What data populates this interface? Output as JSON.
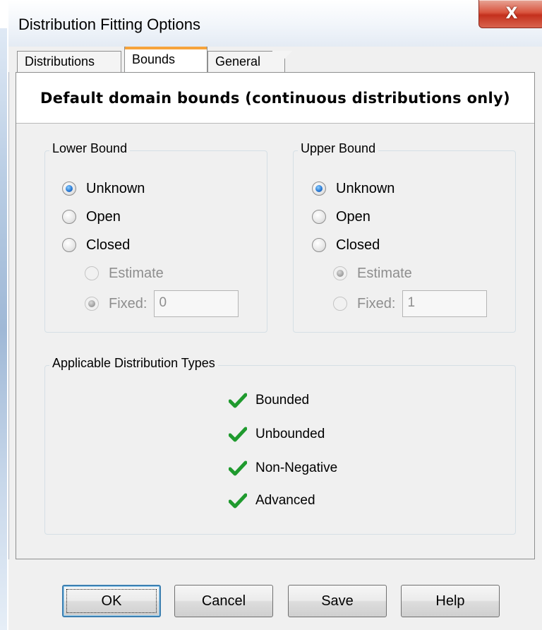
{
  "window": {
    "title": "Distribution Fitting Options",
    "close_label": "X"
  },
  "tabs": [
    {
      "label": "Distributions",
      "active": false
    },
    {
      "label": "Bounds",
      "active": true
    },
    {
      "label": "General",
      "active": false
    }
  ],
  "panel": {
    "header": "Default domain bounds (continuous distributions only)"
  },
  "lower_bound": {
    "label": "Lower Bound",
    "options": [
      "Unknown",
      "Open",
      "Closed"
    ],
    "selected": "Unknown",
    "sub_options": [
      "Estimate",
      "Fixed:"
    ],
    "sub_selected": "Fixed:",
    "fixed_value": "0"
  },
  "upper_bound": {
    "label": "Upper Bound",
    "options": [
      "Unknown",
      "Open",
      "Closed"
    ],
    "selected": "Unknown",
    "sub_options": [
      "Estimate",
      "Fixed:"
    ],
    "sub_selected": "Estimate",
    "fixed_value": "1"
  },
  "distribution_types": {
    "label": "Applicable Distribution Types",
    "items": [
      "Bounded",
      "Unbounded",
      "Non-Negative",
      "Advanced"
    ]
  },
  "buttons": {
    "ok": "OK",
    "cancel": "Cancel",
    "save": "Save",
    "help": "Help"
  },
  "colors": {
    "check": "#1f9a2e",
    "radio_selected": "#2b7bd5",
    "active_tab_accent": "#f6a43c",
    "close_button": "#c4301d"
  },
  "icons": {
    "close": "close-icon",
    "check": "check-icon"
  }
}
